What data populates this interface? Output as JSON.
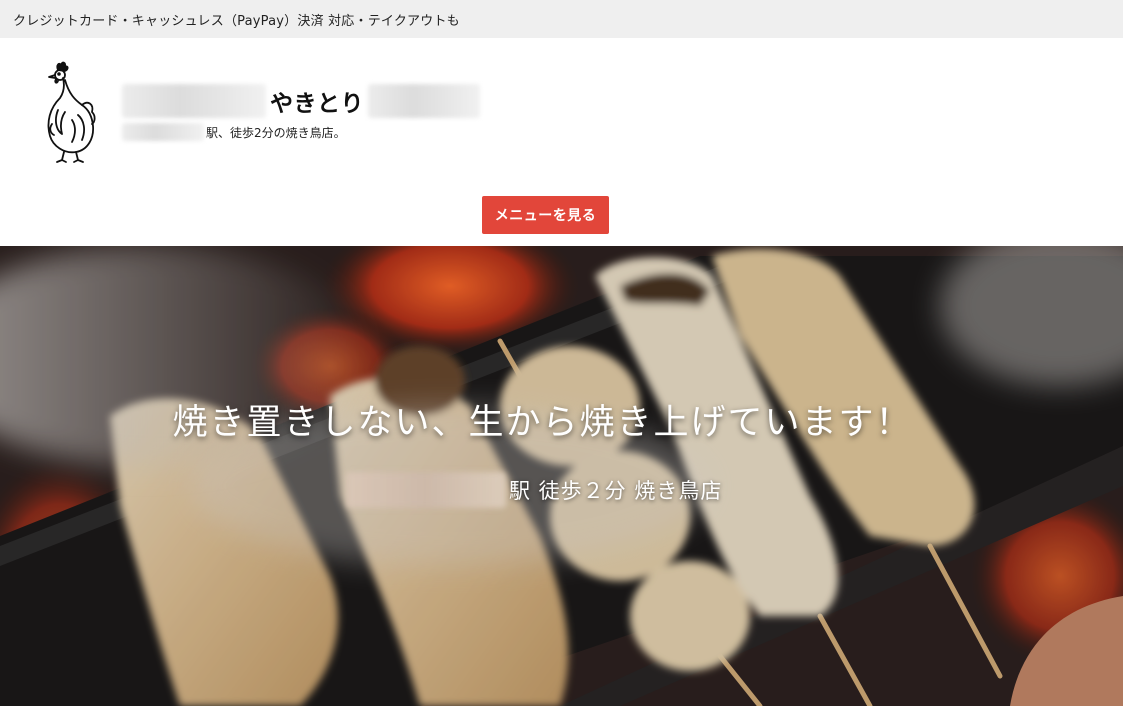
{
  "notice_bar": {
    "text": "クレジットカード・キャッシュレス（PayPay）決済 対応・テイクアウトも"
  },
  "header": {
    "logo_icon": "rooster-icon",
    "brand_name": "やきとり",
    "tagline": "駅、徒歩2分の焼き鳥店。"
  },
  "cta": {
    "menu_button_label": "メニューを見る",
    "color": "#e2463a"
  },
  "hero": {
    "title": "焼き置きしない、生から焼き上げています！",
    "subtitle": "駅 徒歩２分 焼き鳥店"
  }
}
